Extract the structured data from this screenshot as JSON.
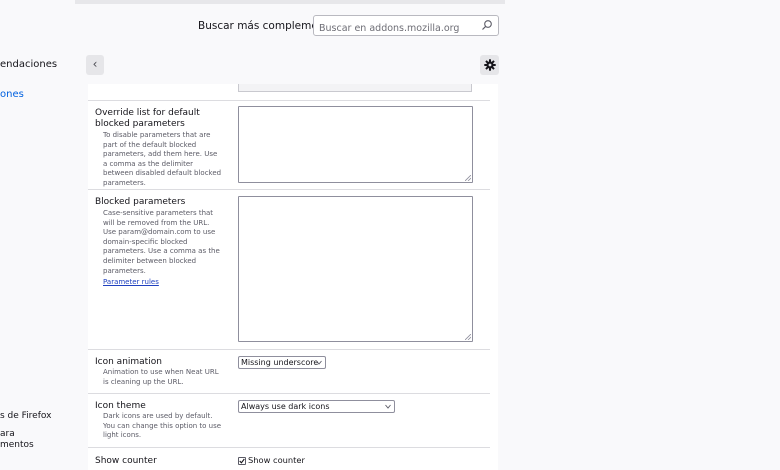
{
  "sidebar": {
    "items": [
      {
        "label": "endaciones"
      },
      {
        "label": "ones"
      },
      {
        "label": "s de Firefox"
      },
      {
        "label": "ara"
      },
      {
        "label": "mentos"
      }
    ]
  },
  "header": {
    "search_label": "Buscar más complementos",
    "search_placeholder": "Buscar en addons.mozilla.org"
  },
  "toolbar": {
    "back_icon": "‹",
    "gear_icon": "gear-icon"
  },
  "prefs": {
    "override": {
      "title": "Override list for default blocked parameters",
      "description": "To disable parameters that are part of the default blocked parameters, add them here. Use a comma as the delimiter between disabled default blocked parameters.",
      "value": ""
    },
    "blocked": {
      "title": "Blocked parameters",
      "description": "Case-sensitive parameters that will be removed from the URL. Use param@domain.com to use domain-specific blocked parameters. Use a comma as the delimiter between blocked parameters.",
      "link": "Parameter rules",
      "value": ""
    },
    "animation": {
      "title": "Icon animation",
      "description": "Animation to use when Neat URL is cleaning up the URL.",
      "selected": "Missing underscore"
    },
    "theme": {
      "title": "Icon theme",
      "description": "Dark icons are used by default. You can change this option to use light icons.",
      "selected": "Always use dark icons"
    },
    "counter": {
      "title": "Show counter",
      "checkbox_label": "Show counter",
      "checked": true
    }
  },
  "colors": {
    "accent": "#0061e0",
    "link": "#1f40bf",
    "background": "#f9f9fb",
    "panel": "#ffffff"
  }
}
